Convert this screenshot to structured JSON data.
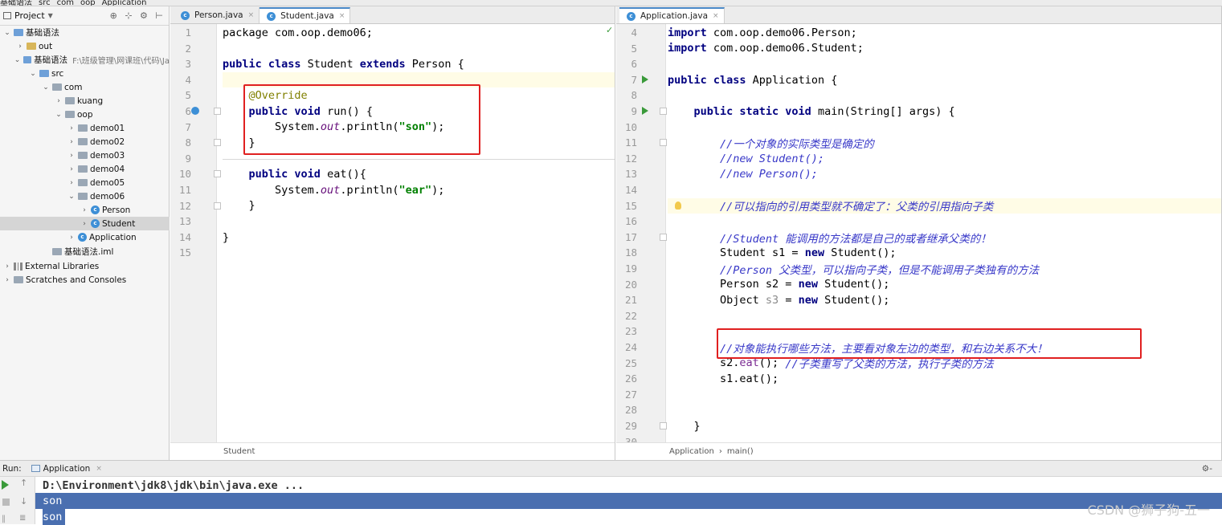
{
  "breadcrumb": [
    "基础语法",
    "src",
    "com",
    "oop",
    "Application"
  ],
  "project_panel": {
    "title": "Project",
    "tree": [
      {
        "label": "基础语法",
        "hint": "",
        "icon": "module-icon",
        "arrow": "v",
        "indent": 0
      },
      {
        "label": "out",
        "hint": "",
        "icon": "folder-icon",
        "arrow": ">",
        "indent": 1
      },
      {
        "label": "基础语法",
        "hint": "F:\\班级管理\\网课班\\代码\\Ja",
        "icon": "module-icon",
        "arrow": "v",
        "indent": 1
      },
      {
        "label": "src",
        "hint": "",
        "icon": "src-folder-icon",
        "arrow": "v",
        "indent": 2
      },
      {
        "label": "com",
        "hint": "",
        "icon": "package-icon",
        "arrow": "v",
        "indent": 3
      },
      {
        "label": "kuang",
        "hint": "",
        "icon": "package-icon",
        "arrow": ">",
        "indent": 4
      },
      {
        "label": "oop",
        "hint": "",
        "icon": "package-icon",
        "arrow": "v",
        "indent": 4
      },
      {
        "label": "demo01",
        "hint": "",
        "icon": "package-icon",
        "arrow": ">",
        "indent": 5
      },
      {
        "label": "demo02",
        "hint": "",
        "icon": "package-icon",
        "arrow": ">",
        "indent": 5
      },
      {
        "label": "demo03",
        "hint": "",
        "icon": "package-icon",
        "arrow": ">",
        "indent": 5
      },
      {
        "label": "demo04",
        "hint": "",
        "icon": "package-icon",
        "arrow": ">",
        "indent": 5
      },
      {
        "label": "demo05",
        "hint": "",
        "icon": "package-icon",
        "arrow": ">",
        "indent": 5
      },
      {
        "label": "demo06",
        "hint": "",
        "icon": "package-icon",
        "arrow": "v",
        "indent": 5
      },
      {
        "label": "Person",
        "hint": "",
        "icon": "class-icon",
        "arrow": ">",
        "indent": 6
      },
      {
        "label": "Student",
        "hint": "",
        "icon": "class-icon",
        "arrow": ">",
        "indent": 6,
        "selected": true
      },
      {
        "label": "Application",
        "hint": "",
        "icon": "class-icon",
        "arrow": ">",
        "indent": 5
      },
      {
        "label": "基础语法.iml",
        "hint": "",
        "icon": "iml-file-icon",
        "arrow": "",
        "indent": 3
      },
      {
        "label": "External Libraries",
        "hint": "",
        "icon": "library-icon",
        "arrow": ">",
        "indent": 0
      },
      {
        "label": "Scratches and Consoles",
        "hint": "",
        "icon": "scratches-icon",
        "arrow": ">",
        "indent": 0
      }
    ]
  },
  "left_editor": {
    "tabs": [
      {
        "label": "Person.java",
        "active": false
      },
      {
        "label": "Student.java",
        "active": true
      }
    ],
    "line_numbers": [
      "1",
      "2",
      "3",
      "4",
      "5",
      "6",
      "7",
      "8",
      "9",
      "10",
      "11",
      "12",
      "13",
      "14",
      "15"
    ],
    "lines": [
      [
        {
          "t": "package com.oop.demo06;",
          "c": ""
        }
      ],
      [],
      [
        {
          "t": "public class ",
          "c": "kw"
        },
        {
          "t": "Student ",
          "c": ""
        },
        {
          "t": "extends ",
          "c": "kw"
        },
        {
          "t": "Person {",
          "c": ""
        }
      ],
      [],
      [
        {
          "t": "    @Override",
          "c": "ann"
        }
      ],
      [
        {
          "t": "    ",
          "c": ""
        },
        {
          "t": "public void ",
          "c": "kw"
        },
        {
          "t": "run() {",
          "c": ""
        }
      ],
      [
        {
          "t": "        System.",
          "c": ""
        },
        {
          "t": "out",
          "c": "fld"
        },
        {
          "t": ".println(",
          "c": ""
        },
        {
          "t": "\"son\"",
          "c": "str"
        },
        {
          "t": ");",
          "c": ""
        }
      ],
      [
        {
          "t": "    }",
          "c": ""
        }
      ],
      [],
      [
        {
          "t": "    ",
          "c": ""
        },
        {
          "t": "public void ",
          "c": "kw"
        },
        {
          "t": "eat(){",
          "c": ""
        }
      ],
      [
        {
          "t": "        System.",
          "c": ""
        },
        {
          "t": "out",
          "c": "fld"
        },
        {
          "t": ".println(",
          "c": ""
        },
        {
          "t": "\"ear\"",
          "c": "str"
        },
        {
          "t": ");",
          "c": ""
        }
      ],
      [
        {
          "t": "    }",
          "c": ""
        }
      ],
      [],
      [
        {
          "t": "}",
          "c": ""
        }
      ],
      []
    ],
    "status_breadcrumb": [
      "Student"
    ]
  },
  "right_editor": {
    "tabs": [
      {
        "label": "Application.java",
        "active": true
      }
    ],
    "line_numbers": [
      "4",
      "5",
      "6",
      "7",
      "8",
      "9",
      "10",
      "11",
      "12",
      "13",
      "14",
      "15",
      "16",
      "17",
      "18",
      "19",
      "20",
      "21",
      "22",
      "23",
      "24",
      "25",
      "26",
      "27",
      "28",
      "29",
      "30"
    ],
    "lines": [
      [
        {
          "t": "import ",
          "c": "kw"
        },
        {
          "t": "com.oop.demo06.Person;",
          "c": ""
        }
      ],
      [
        {
          "t": "import ",
          "c": "kw"
        },
        {
          "t": "com.oop.demo06.Student;",
          "c": ""
        }
      ],
      [],
      [
        {
          "t": "public class ",
          "c": "kw"
        },
        {
          "t": "Application {",
          "c": ""
        }
      ],
      [],
      [
        {
          "t": "    ",
          "c": ""
        },
        {
          "t": "public static void ",
          "c": "kw"
        },
        {
          "t": "main(String[] args) {",
          "c": ""
        }
      ],
      [],
      [
        {
          "t": "        //一个对象的实际类型是确定的",
          "c": "cmt"
        }
      ],
      [
        {
          "t": "        //new Student();",
          "c": "cmt"
        }
      ],
      [
        {
          "t": "        //new Person();",
          "c": "cmt"
        }
      ],
      [],
      [
        {
          "t": "        //可以指向的引用类型就不确定了：父类的引用指向子类",
          "c": "cmt"
        }
      ],
      [],
      [
        {
          "t": "        //Student 能调用的方法都是自己的或者继承父类的！",
          "c": "cmt"
        }
      ],
      [
        {
          "t": "        Student s1 = ",
          "c": ""
        },
        {
          "t": "new ",
          "c": "kw"
        },
        {
          "t": "Student();",
          "c": ""
        }
      ],
      [
        {
          "t": "        //Person 父类型，可以指向子类，但是不能调用子类独有的方法",
          "c": "cmt"
        }
      ],
      [
        {
          "t": "        Person s2 = ",
          "c": ""
        },
        {
          "t": "new ",
          "c": "kw"
        },
        {
          "t": "Student();",
          "c": ""
        }
      ],
      [
        {
          "t": "        Object ",
          "c": ""
        },
        {
          "t": "s3",
          "c": "unused"
        },
        {
          "t": " = ",
          "c": ""
        },
        {
          "t": "new ",
          "c": "kw"
        },
        {
          "t": "Student();",
          "c": ""
        }
      ],
      [],
      [],
      [
        {
          "t": "        //对象能执行哪些方法，主要看对象左边的类型，和右边关系不大！",
          "c": "cmt"
        }
      ],
      [
        {
          "t": "        s2.",
          "c": ""
        },
        {
          "t": "eat",
          "c": "mth"
        },
        {
          "t": "(); ",
          "c": ""
        },
        {
          "t": "//子类重写了父类的方法，执行子类的方法",
          "c": "cmt"
        }
      ],
      [
        {
          "t": "        s1.eat();",
          "c": ""
        }
      ],
      [],
      [],
      [
        {
          "t": "    }",
          "c": ""
        }
      ],
      []
    ],
    "status_breadcrumb": [
      "Application",
      "main()"
    ]
  },
  "run_panel": {
    "label": "Run:",
    "tab": "Application",
    "output": [
      "D:\\Environment\\jdk8\\jdk\\bin\\java.exe ...",
      "son",
      "son"
    ]
  },
  "watermark": "CSDN @狮子狗-五一",
  "colors": {
    "keyword": "#000080",
    "string": "#008000",
    "comment": "#3838c8",
    "annotation": "#808000",
    "highlight_box": "#e02020",
    "selection": "#4a6fb0"
  }
}
